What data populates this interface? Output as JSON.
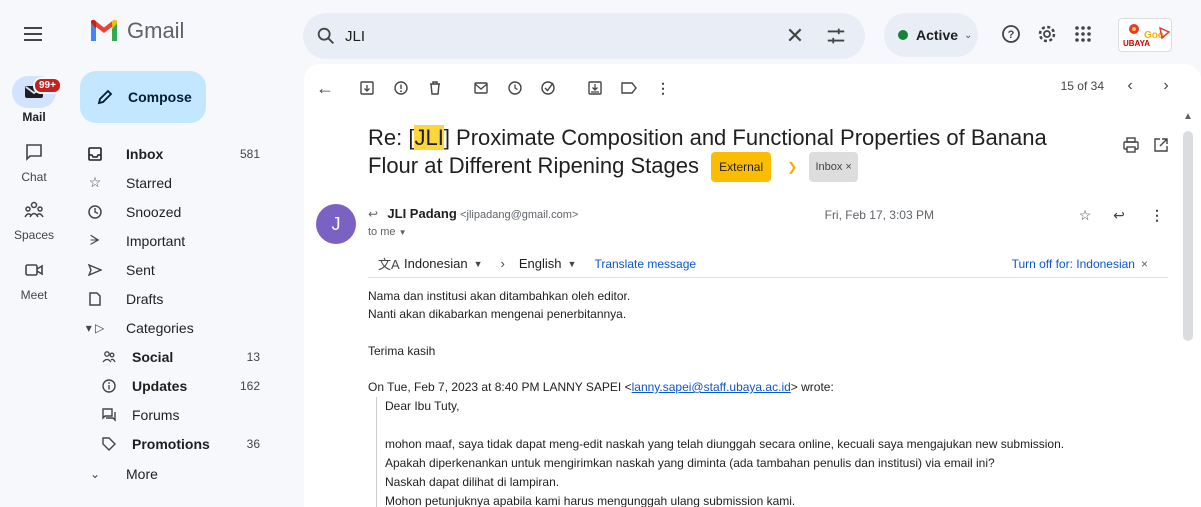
{
  "header": {
    "app_name": "Gmail",
    "search_query": "JLI",
    "status": "Active",
    "ubaya_logo_text": "UBAYA"
  },
  "rail": [
    {
      "label": "Mail",
      "badge": "99+",
      "icon": "mail-icon"
    },
    {
      "label": "Chat",
      "icon": "chat-icon"
    },
    {
      "label": "Spaces",
      "icon": "spaces-icon"
    },
    {
      "label": "Meet",
      "icon": "meet-icon"
    }
  ],
  "nav": {
    "compose_label": "Compose",
    "items": [
      {
        "label": "Inbox",
        "count": "581",
        "bold": true
      },
      {
        "label": "Starred",
        "count": ""
      },
      {
        "label": "Snoozed",
        "count": ""
      },
      {
        "label": "Important",
        "count": ""
      },
      {
        "label": "Sent",
        "count": ""
      },
      {
        "label": "Drafts",
        "count": ""
      },
      {
        "label": "Categories",
        "count": ""
      },
      {
        "label": "Social",
        "count": "13",
        "bold": true
      },
      {
        "label": "Updates",
        "count": "162",
        "bold": true
      },
      {
        "label": "Forums",
        "count": ""
      },
      {
        "label": "Promotions",
        "count": "36",
        "bold": true
      },
      {
        "label": "More",
        "count": ""
      }
    ]
  },
  "toolbar": {
    "pager_text": "15 of 34"
  },
  "email": {
    "subject_prefix": "Re: [",
    "subject_highlight": "JLI",
    "subject_rest": "] Proximate Composition and Functional Properties of Banana Flour at Different Ripening Stages",
    "label_external": "External",
    "label_inbox": "Inbox ×",
    "avatar_letter": "J",
    "sender_name": "JLI Padang",
    "sender_email": "<jlipadang@gmail.com>",
    "to": "to me",
    "date": "Fri, Feb 17, 3:03 PM",
    "translate": {
      "from_lang": "Indonesian",
      "to_lang": "English",
      "translate_link": "Translate message",
      "turn_off": "Turn off for: Indonesian"
    },
    "body_lines": [
      "Nama dan institusi akan ditambahkan oleh editor.",
      "Nanti akan dikabarkan mengenai penerbitannya.",
      "Terima kasih"
    ],
    "quote_header_prefix": "On Tue, Feb 7, 2023 at 8:40 PM LANNY SAPEI <",
    "quote_header_email": "lanny.sapei@staff.ubaya.ac.id",
    "quote_header_suffix": "> wrote:",
    "quoted_lines": [
      "Dear Ibu Tuty,",
      "",
      "mohon maaf, saya tidak dapat meng-edit naskah yang telah diunggah secara online, kecuali saya mengajukan new submission.",
      "Apakah diperkenankan untuk mengirimkan naskah yang diminta (ada tambahan penulis dan institusi) via email ini?",
      "Naskah dapat dilihat di lampiran.",
      "Mohon petunjuknya apabila kami harus mengunggah ulang submission kami."
    ]
  },
  "colors": {
    "compose_bg": "#c2e7ff",
    "active_dot": "#188038",
    "badge": "#c5221f",
    "avatar": "#7b61c2",
    "highlight": "#fcd63a",
    "external_label": "#fbbc04",
    "link": "#0b57d0"
  }
}
